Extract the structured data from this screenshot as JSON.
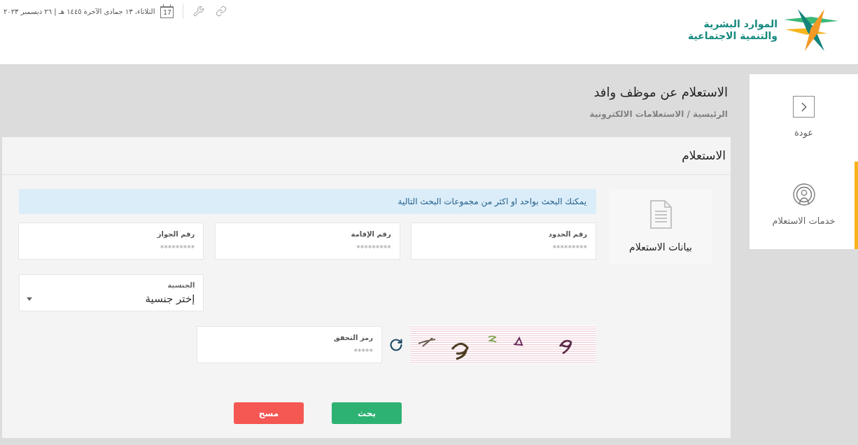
{
  "header": {
    "logo": {
      "lines": [
        "الموارد البشرية",
        "والتنمية الاجتماعية"
      ]
    },
    "calendar_day": "17",
    "date": "الثلاثاء، ١٣ جمادى الآخرة ١٤٤٥ هـ | ٢٦ ديسمبر ٢٠٢٣"
  },
  "sidebar": {
    "items": [
      {
        "kind": "back",
        "label": "عودة",
        "selected": false
      },
      {
        "kind": "services",
        "label": "خدمات الاستعلام",
        "selected": true
      }
    ]
  },
  "page": {
    "title": "الاستعلام عن موظف وافد",
    "breadcrumb": "الرئيسية / الاستعلامات الالكترونية"
  },
  "card": {
    "title": "الاستعلام",
    "step": {
      "label": "بيانات الاستعلام"
    },
    "alert": "يمكنك البحث بواحد او اكثر من مجموعات البحث التالية",
    "fields": [
      {
        "kind": "text",
        "label": "رقم الحدود",
        "placeholder": "*********"
      },
      {
        "kind": "text",
        "label": "رقم الإقامة",
        "placeholder": "*********"
      },
      {
        "kind": "text",
        "label": "رقم الجواز",
        "placeholder": "*********"
      },
      {
        "kind": "select",
        "label": "الجنسية",
        "value": "إختر جنسية"
      }
    ],
    "captcha": {
      "label": "رمز التحقق",
      "placeholder": "*****"
    },
    "buttons": [
      {
        "kind": "primary",
        "label": "بحث"
      },
      {
        "kind": "danger",
        "label": "مسح"
      }
    ]
  }
}
